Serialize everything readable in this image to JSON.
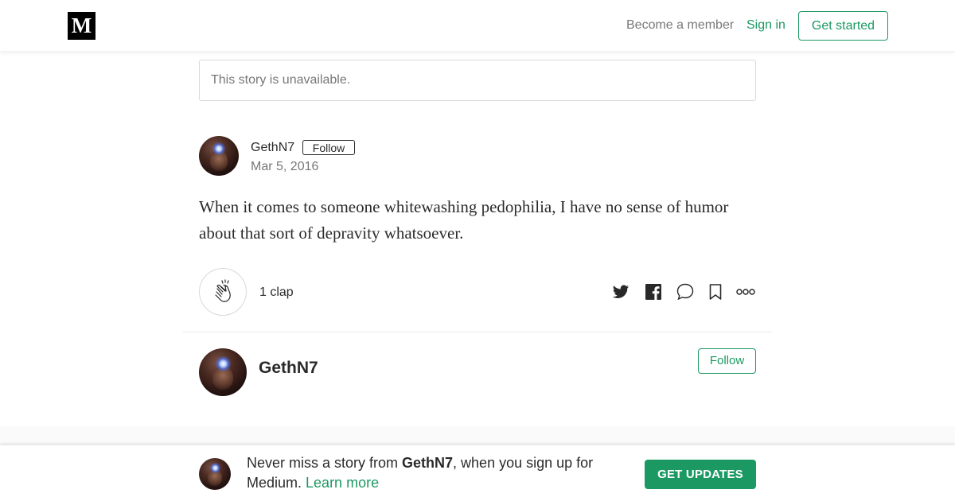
{
  "header": {
    "logo_text": "M",
    "become_member": "Become a member",
    "sign_in": "Sign in",
    "get_started": "Get started"
  },
  "notice": {
    "text": "This story is unavailable."
  },
  "post": {
    "author_name": "GethN7",
    "follow_label": "Follow",
    "date": "Mar 5, 2016",
    "body": "When it comes to someone whitewashing pedophilia, I have no sense of humor about that sort of depravity whatsoever.",
    "clap_count": "1 clap",
    "actions": [
      "twitter-icon",
      "facebook-icon",
      "comment-icon",
      "bookmark-icon",
      "more-icon"
    ]
  },
  "author_card": {
    "name": "GethN7",
    "follow_label": "Follow"
  },
  "footer_banner": {
    "prefix": "Never miss a story from ",
    "author": "GethN7",
    "suffix": ", when you sign up for Medium. ",
    "learn_more": "Learn more",
    "button": "GET UPDATES"
  },
  "colors": {
    "accent": "#1c9963",
    "text": "rgba(0,0,0,0.84)",
    "muted": "rgba(0,0,0,0.54)"
  }
}
